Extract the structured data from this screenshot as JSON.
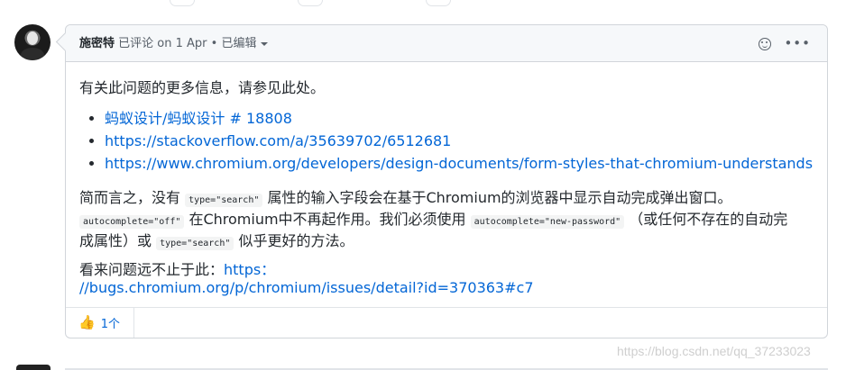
{
  "comment": {
    "author": "施密特",
    "meta_action": " 已评论 ",
    "meta_date": "on 1 Apr",
    "meta_sep": " • ",
    "meta_edited": "已编辑",
    "intro": "有关此问题的更多信息，请参见此处。",
    "links": [
      "蚂蚁设计/蚂蚁设计 # 18808",
      "https://stackoverflow.com/a/35639702/6512681",
      "https://www.chromium.org/developers/design-documents/form-styles-that-chromium-understands"
    ],
    "para2": {
      "t1": "简而言之，没有 ",
      "c1": "type=\"search\"",
      "t2": " 属性的输入字段会在基于Chromium的浏览器中显示自动完成弹出窗口。 ",
      "c2": "autocomplete=\"off\"",
      "t3": " 在Chromium中不再起作用。我们必须使用 ",
      "c3": "autocomplete=\"new-password\"",
      "t4": " （或任何不存在的自动完成属性）或 ",
      "c4": "type=\"search\"",
      "t5": " 似乎更好的方法。"
    },
    "para3": {
      "text": "看来问题远不止于此：",
      "link1": "https：",
      "link2": "//bugs.chromium.org/p/chromium/issues/detail?id=370363#c7"
    },
    "reaction": {
      "icon": "thumbs-up",
      "count": "1个"
    }
  },
  "watermark": "https://blog.csdn.net/qq_37233023"
}
